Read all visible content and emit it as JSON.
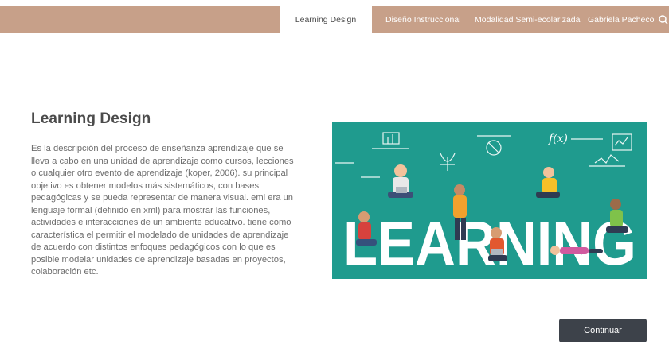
{
  "nav": {
    "items": [
      {
        "label": "Learning Design",
        "active": true
      },
      {
        "label": "Diseño Instruccional",
        "active": false
      },
      {
        "label": "Modalidad Semi-ecolarizada",
        "active": false
      },
      {
        "label": "Gabriela Pacheco",
        "active": false
      }
    ],
    "search_icon": "search-icon"
  },
  "content": {
    "title": "Learning Design",
    "description": "Es la descripción del proceso de enseñanza aprendizaje que se lleva a cabo en una unidad de aprendizaje como cursos, lecciones o cualquier otro evento de aprendizaje (koper, 2006). su principal objetivo es obtener modelos más sistemáticos, con bases pedagógicas y se pueda representar de manera visual. eml era un lenguaje formal (definido en xml) para mostrar las funciones, actividades e interacciones de un ambiente educativo. tiene como característica el permitir el modelado de unidades de aprendizaje de acuerdo con distintos enfoques pedagógicos con lo que es posible modelar unidades de aprendizaje basadas en proyectos, colaboración etc."
  },
  "illustration": {
    "word": "LEARNING",
    "background": "#1f9b8e",
    "formula_fx": "f(x)"
  },
  "actions": {
    "continue_label": "Continuar"
  },
  "colors": {
    "navbar": "#c7a089",
    "button": "#3d424a",
    "illustration_bg": "#1f9b8e"
  }
}
